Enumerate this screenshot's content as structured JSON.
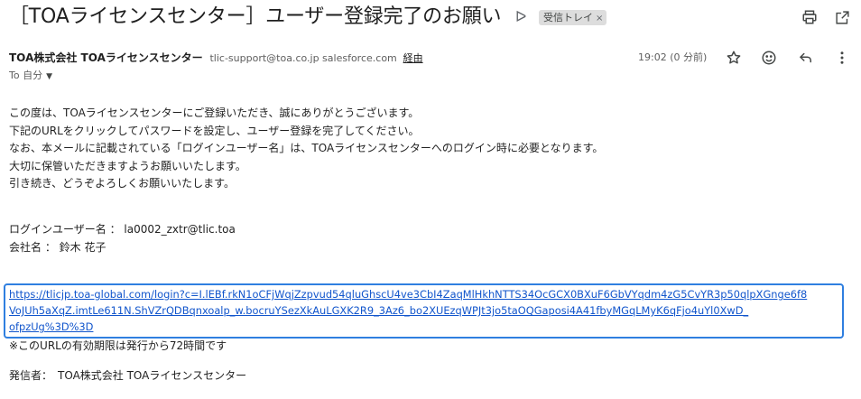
{
  "subject": {
    "title": "［TOAライセンスセンター］ユーザー登録完了のお願い",
    "important_marker": "ᐅ",
    "label": "受信トレイ",
    "label_remove": "×"
  },
  "toolbar": {
    "print_icon": "print-icon",
    "open_new_window_icon": "open-in-new-window-icon"
  },
  "sender": {
    "name": "TOA株式会社 TOAライセンスセンター",
    "email": "tlic-support@toa.co.jp salesforce.com",
    "via": "経由",
    "to": "To 自分",
    "time": "19:02 (0 分前)"
  },
  "actions": {
    "star": "star-icon",
    "emoji": "emoji-icon",
    "reply": "reply-icon",
    "more": "more-vert-icon"
  },
  "body": {
    "paragraph_lines": [
      "この度は、TOAライセンスセンターにご登録いただき、誠にありがとうございます。",
      "下記のURLをクリックしてパスワードを設定し、ユーザー登録を完了してください。",
      "なお、本メールに記載されている「ログインユーザー名」は、TOAライセンスセンターへのログイン時に必要となります。",
      "大切に保管いただきますようお願いいたします。",
      "引き続き、どうぞよろしくお願いいたします。"
    ],
    "login_user": "ログインユーザー名 ： la0002_zxtr@tlic.toa",
    "company": "会社名 ： 鈴木 花子",
    "link_lines": [
      "https://tlicjp.toa-global.com/login?c=I.lEBf.rkN1oCFjWqjZzpvud54qluGhscU4ve3CbI4ZaqMlHkhNTTS34OcGCX0BXuF6GbVYqdm4zG5CvYR3p50qlpXGnge6f8",
      "VoJUh5aXqZ.imtLe611N.ShVZrQDBqnxoalp_w.bocruYSezXkAuLGXK2R9_3Az6_bo2XUEzqWPJt3jo5taOQGaposi4A41fbyMGqLMyK6qFjo4uYl0XwD_",
      "ofpzUg%3D%3D"
    ],
    "expiry_note": "※このURLの有効期限は発行から72時間です",
    "sender_line": "発信者：　TOA株式会社 TOAライセンスセンター"
  },
  "colors": {
    "link": "#1155cc",
    "highlight_box": "#2f7fe0",
    "chip_bg": "#dddddd"
  }
}
